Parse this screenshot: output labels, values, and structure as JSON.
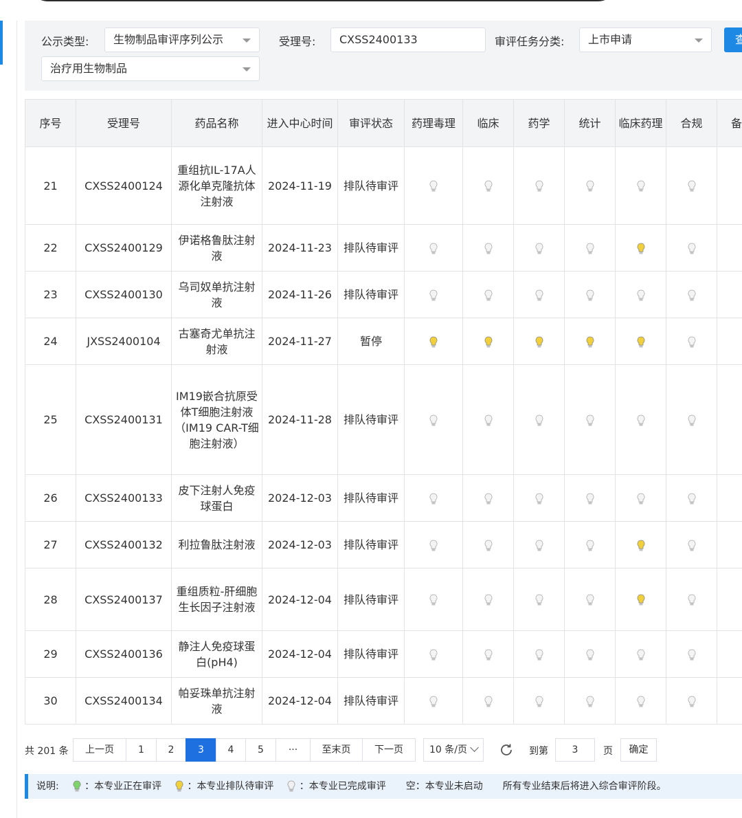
{
  "filters": {
    "type_label": "公示类型:",
    "type_value": "生物制品审评序列公示",
    "sub_value": "治疗用生物制品",
    "acc_label": "受理号:",
    "acc_value": "CXSS2400133",
    "task_label": "审评任务分类:",
    "task_value": "上市申请",
    "query_label": "查"
  },
  "table": {
    "headers": [
      "序号",
      "受理号",
      "药品名称",
      "进入中心时间",
      "审评状态",
      "药理毒理",
      "临床",
      "药学",
      "统计",
      "临床药理",
      "合规",
      "备注"
    ],
    "rows": [
      {
        "no": "21",
        "acc": "CXSS2400124",
        "name": "重组抗IL-17A人源化单克隆抗体注射液",
        "date": "2024-11-19",
        "status": "排队待审评",
        "lights": [
          "grey",
          "grey",
          "grey",
          "grey",
          "grey",
          "grey"
        ],
        "highlight": false
      },
      {
        "no": "22",
        "acc": "CXSS2400129",
        "name": "伊诺格鲁肽注射液",
        "date": "2024-11-23",
        "status": "排队待审评",
        "lights": [
          "grey",
          "grey",
          "grey",
          "grey",
          "yellow",
          "grey"
        ],
        "highlight": false
      },
      {
        "no": "23",
        "acc": "CXSS2400130",
        "name": "乌司奴单抗注射液",
        "date": "2024-11-26",
        "status": "排队待审评",
        "lights": [
          "grey",
          "grey",
          "grey",
          "grey",
          "grey",
          "grey"
        ],
        "highlight": false
      },
      {
        "no": "24",
        "acc": "JXSS2400104",
        "name": "古塞奇尤单抗注射液",
        "date": "2024-11-27",
        "status": "暂停",
        "lights": [
          "yellow",
          "yellow",
          "yellow",
          "yellow",
          "yellow",
          "grey"
        ],
        "highlight": false
      },
      {
        "no": "25",
        "acc": "CXSS2400131",
        "name": "IM19嵌合抗原受体T细胞注射液（IM19 CAR-T细胞注射液）",
        "date": "2024-11-28",
        "status": "排队待审评",
        "lights": [
          "grey",
          "grey",
          "grey",
          "grey",
          "grey",
          "grey"
        ],
        "highlight": false
      },
      {
        "no": "26",
        "acc": "CXSS2400133",
        "name": "皮下注射人免疫球蛋白",
        "date": "2024-12-03",
        "status": "排队待审评",
        "lights": [
          "grey",
          "grey",
          "grey",
          "grey",
          "grey",
          "grey"
        ],
        "highlight": true
      },
      {
        "no": "27",
        "acc": "CXSS2400132",
        "name": "利拉鲁肽注射液",
        "date": "2024-12-03",
        "status": "排队待审评",
        "lights": [
          "grey",
          "grey",
          "grey",
          "grey",
          "yellow",
          "grey"
        ],
        "highlight": false
      },
      {
        "no": "28",
        "acc": "CXSS2400137",
        "name": "重组质粒-肝细胞生长因子注射液",
        "date": "2024-12-04",
        "status": "排队待审评",
        "lights": [
          "grey",
          "grey",
          "grey",
          "grey",
          "yellow",
          "grey"
        ],
        "highlight": false
      },
      {
        "no": "29",
        "acc": "CXSS2400136",
        "name": "静注人免疫球蛋白(pH4)",
        "date": "2024-12-04",
        "status": "排队待审评",
        "lights": [
          "grey",
          "grey",
          "grey",
          "grey",
          "grey",
          "grey"
        ],
        "highlight": false
      },
      {
        "no": "30",
        "acc": "CXSS2400134",
        "name": "帕妥珠单抗注射液",
        "date": "2024-12-04",
        "status": "排队待审评",
        "lights": [
          "grey",
          "grey",
          "grey",
          "grey",
          "grey",
          "grey"
        ],
        "highlight": false
      }
    ]
  },
  "pager": {
    "total": "共 201 条",
    "prev": "上一页",
    "pages": [
      "1",
      "2",
      "3",
      "4",
      "5",
      "···"
    ],
    "active_page": "3",
    "last": "至末页",
    "next": "下一页",
    "size": "10 条/页",
    "goto_label": "到第",
    "goto_value": "3",
    "page_unit": "页",
    "confirm": "确定"
  },
  "legend": {
    "title": "说明:",
    "green": "本专业正在审评",
    "yellow": "本专业排队待审评",
    "grey": "本专业已完成审评",
    "empty": "空：本专业未启动",
    "note": "所有专业结束后将进入综合审评阶段。"
  },
  "colors": {
    "accent": "#1e88e5",
    "highlight_text": "#c62828",
    "bulb_grey": "#d8d8d8",
    "bulb_yellow": "#f2d03b",
    "bulb_green": "#7ed36a"
  }
}
